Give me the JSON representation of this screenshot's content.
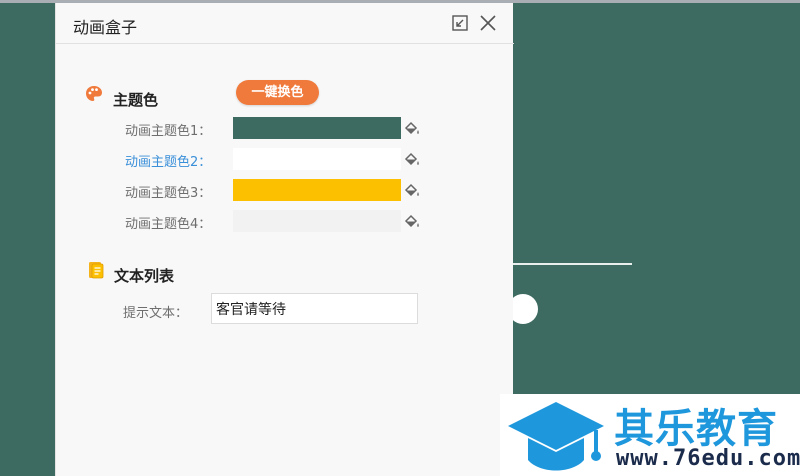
{
  "panel": {
    "title": "动画盒子",
    "restore_icon": "restore-icon",
    "close_icon": "close-icon"
  },
  "theme": {
    "section_title": "主题色",
    "section_icon": "palette-icon",
    "swap_button": "一键换色",
    "colors": [
      {
        "label": "动画主题色1：",
        "color": "#3e6b61",
        "active": false
      },
      {
        "label": "动画主题色2：",
        "color": "#ffffff",
        "active": true
      },
      {
        "label": "动画主题色3：",
        "color": "#fcc000",
        "active": false
      },
      {
        "label": "动画主题色4：",
        "color": "#f2f2f2",
        "active": false
      }
    ],
    "bucket_icon": "paint-bucket-icon"
  },
  "text_list": {
    "section_title": "文本列表",
    "section_icon": "document-icon",
    "prompt_label": "提示文本：",
    "prompt_value": "客官请等待"
  },
  "watermark": {
    "brand": "其乐教育",
    "url": "www.76edu.com",
    "logo_icon": "graduation-cap-icon"
  },
  "colors": {
    "background": "#3e6b61",
    "accent": "#f07a3c",
    "active_label": "#3a8fd9",
    "brand": "#1e97dc"
  }
}
